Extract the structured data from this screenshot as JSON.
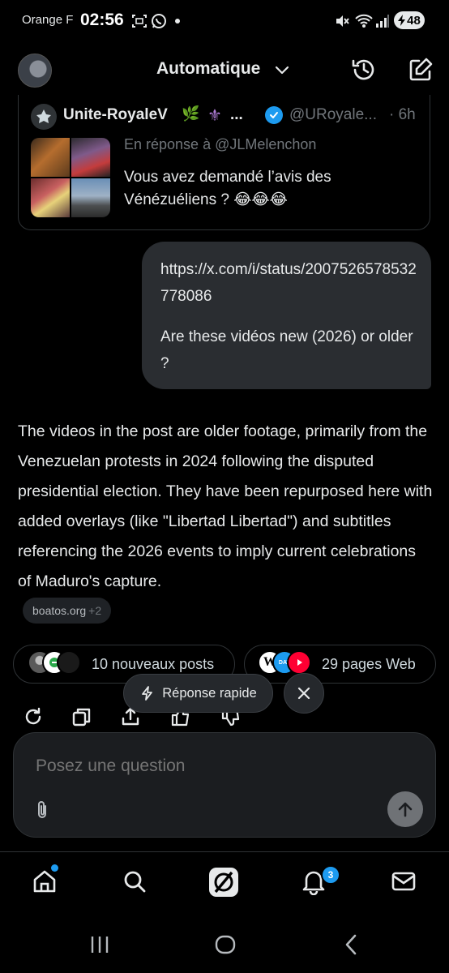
{
  "status_bar": {
    "carrier": "Orange F",
    "time": "02:56",
    "battery": "48"
  },
  "header": {
    "title": "Automatique"
  },
  "quoted_post": {
    "name": "Unite-RoyaleV",
    "name_emoji": "🌿",
    "name_symbol": "⚜",
    "ellipsis": "...",
    "handle": "@URoyale...",
    "time": "· 6h",
    "reply_to": "En réponse à @JLMelenchon",
    "text": "Vous avez demandé l’avis des Vénézuéliens ? 😂😂😂"
  },
  "user_message": {
    "link": "https://x.com/i/status/2007526578532778086",
    "question": "Are these vidéos new (2026) or older ?"
  },
  "answer": {
    "text": "The videos in the post are older footage, primarily from the Venezuelan protests in 2024 following the disputed presidential election. They have been repurposed here with added overlays (like \"Libertad Libertad\") and subtitles referencing the 2026 events to imply current celebrations of Maduro's capture.",
    "source_label": "boatos.org",
    "source_more": "+2"
  },
  "pills": {
    "posts": "10 nouveaux posts",
    "web": "29 pages Web",
    "web_logo_letter": "W",
    "day_label": "DAY"
  },
  "quick_reply": {
    "label": "Réponse rapide"
  },
  "composer": {
    "placeholder": "Posez une question",
    "value": ""
  },
  "nav": {
    "notifications_count": "3"
  },
  "colors": {
    "accent": "#1d9bf0",
    "background": "#000000",
    "bubble": "#2a2d31"
  }
}
